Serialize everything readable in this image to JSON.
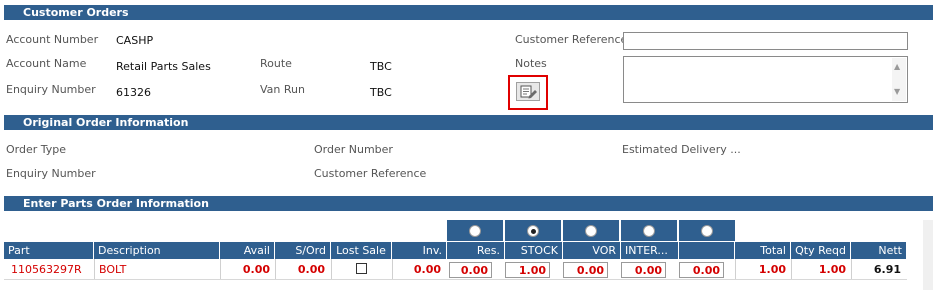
{
  "customer_orders": {
    "title": "Customer Orders",
    "account_number_label": "Account Number",
    "account_number": "CASHP",
    "account_name_label": "Account Name",
    "account_name": "Retail Parts Sales",
    "enquiry_number_label": "Enquiry Number",
    "enquiry_number": "61326",
    "route_label": "Route",
    "route": "TBC",
    "van_run_label": "Van Run",
    "van_run": "TBC",
    "customer_reference_label": "Customer Reference",
    "customer_reference_value": "",
    "notes_label": "Notes",
    "notes_value": ""
  },
  "original_order": {
    "title": "Original Order Information",
    "order_type_label": "Order Type",
    "order_number_label": "Order Number",
    "estimated_delivery_label": "Estimated Delivery ...",
    "enquiry_number_label": "Enquiry Number",
    "customer_reference_label": "Customer Reference"
  },
  "parts_order": {
    "title": "Enter Parts Order Information",
    "radios": [
      false,
      true,
      false,
      false,
      false
    ],
    "headers": {
      "part": "Part",
      "description": "Description",
      "avail": "Avail",
      "sord": "S/Ord",
      "lost_sale": "Lost Sale",
      "inv": "Inv.",
      "res": "Res.",
      "stock": "STOCK",
      "vor": "VOR",
      "inter": "INTER...",
      "extra": "",
      "total": "Total",
      "qty_reqd": "Qty Reqd",
      "nett": "Nett"
    },
    "row": {
      "part": "110563297R",
      "description": "BOLT",
      "avail": "0.00",
      "sord": "0.00",
      "lost_sale": false,
      "inv": "0.00",
      "res": "0.00",
      "stock": "1.00",
      "vor": "0.00",
      "inter": "0.00",
      "extra": "0.00",
      "total": "1.00",
      "qty_reqd": "1.00",
      "nett": "6.91"
    }
  },
  "colors": {
    "header_bar": "#2f5f8f",
    "value_red": "#d40000",
    "highlight": "#e00000"
  },
  "icons": {
    "notes_button": "document-edit-icon"
  }
}
